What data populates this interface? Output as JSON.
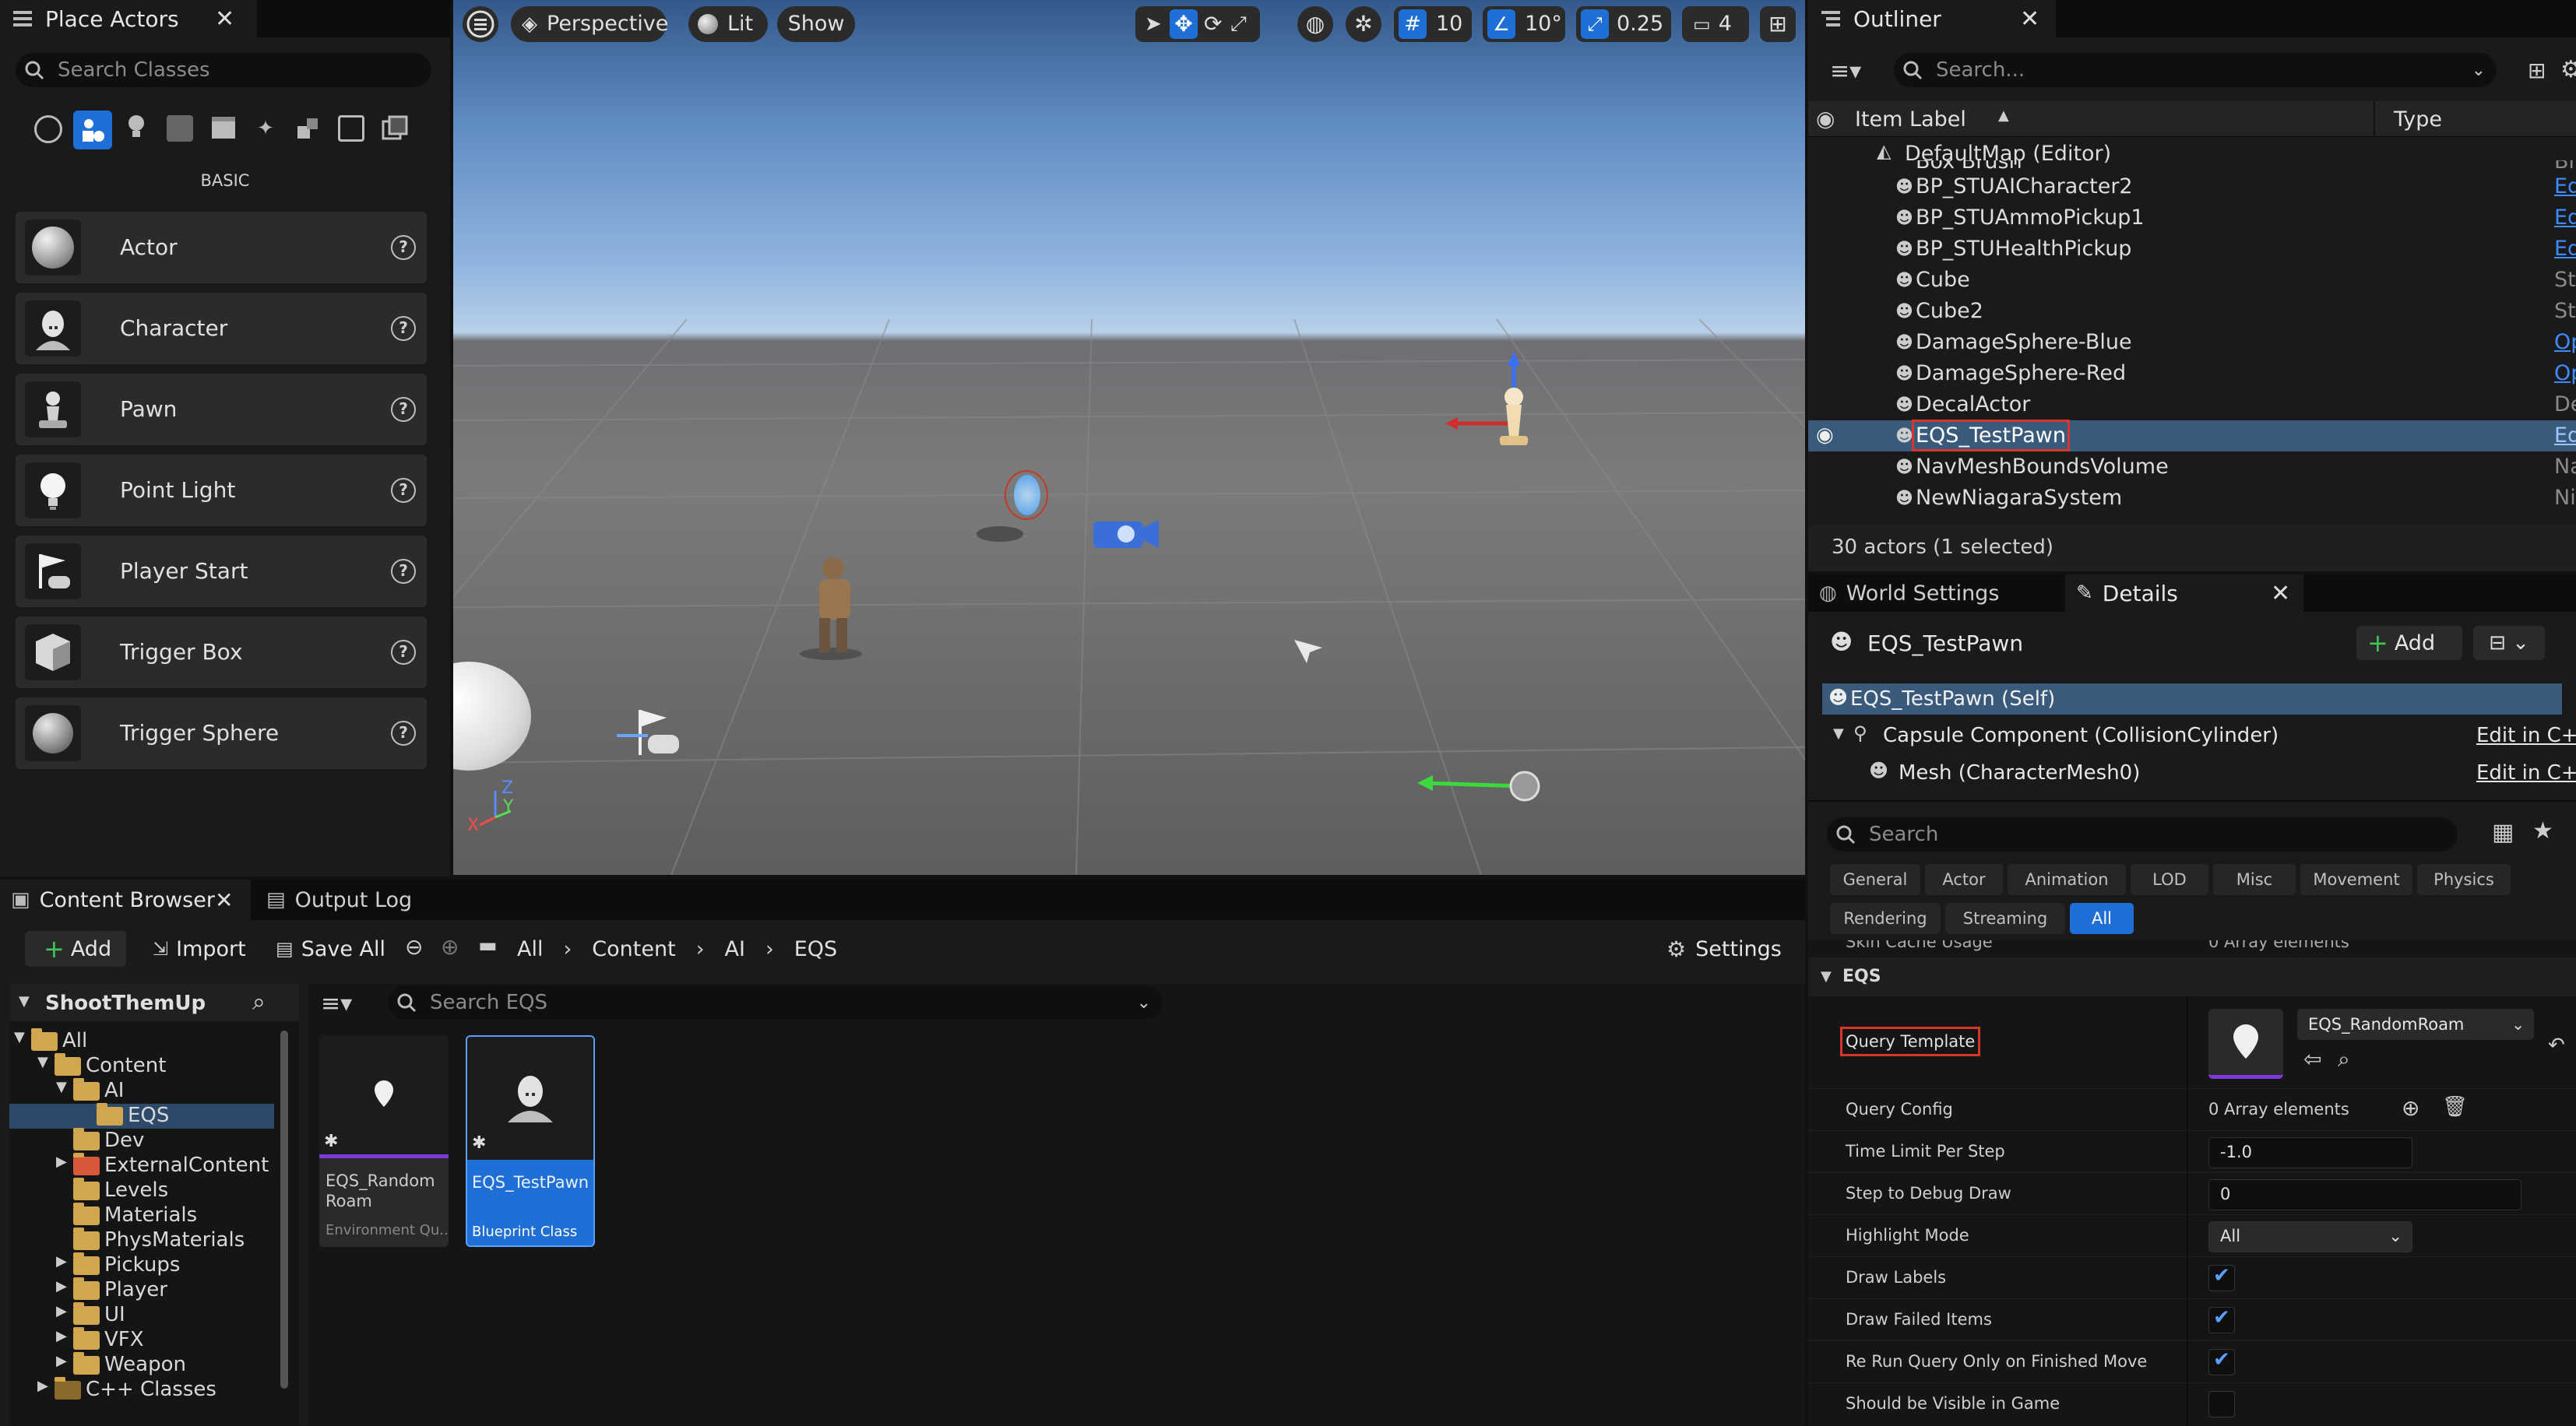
{
  "place_actors": {
    "tab_title": "Place Actors",
    "search_placeholder": "Search Classes",
    "section_label": "BASIC",
    "items": [
      {
        "label": "Actor",
        "icon": "sphere-icon"
      },
      {
        "label": "Character",
        "icon": "character-icon"
      },
      {
        "label": "Pawn",
        "icon": "pawn-icon"
      },
      {
        "label": "Point Light",
        "icon": "light-bulb-icon"
      },
      {
        "label": "Player Start",
        "icon": "player-start-icon"
      },
      {
        "label": "Trigger Box",
        "icon": "trigger-box-icon"
      },
      {
        "label": "Trigger Sphere",
        "icon": "trigger-sphere-icon"
      }
    ]
  },
  "viewport": {
    "perspective": "Perspective",
    "lit": "Lit",
    "show": "Show",
    "grid_snap": "10",
    "rotation_snap": "10°",
    "scale_snap": "0.25",
    "camera_speed": "4",
    "axis_z": "Z",
    "axis_y": "Y",
    "axis_x": "X"
  },
  "outliner": {
    "tab_title": "Outliner",
    "search_placeholder": "Search...",
    "col_label": "Item Label",
    "col_type": "Type",
    "root": "DefaultMap (Editor)",
    "partial_row": {
      "name": "Box Brush",
      "type": "Brush"
    },
    "rows": [
      {
        "name": "BP_STUAICharacter2",
        "type": "Edit BP_STUAIChara",
        "link": true
      },
      {
        "name": "BP_STUAmmoPickup1",
        "type": "Edit BP_STUAmmoP",
        "link": true
      },
      {
        "name": "BP_STUHealthPickup",
        "type": "Edit BP_STUHealthP",
        "link": true
      },
      {
        "name": "Cube",
        "type": "StaticMeshActor",
        "link": false
      },
      {
        "name": "Cube2",
        "type": "StaticMeshActor",
        "link": false
      },
      {
        "name": "DamageSphere-Blue",
        "type": "Open STUDevDamag",
        "link": true
      },
      {
        "name": "DamageSphere-Red",
        "type": "Open STUDevDamag",
        "link": true
      },
      {
        "name": "DecalActor",
        "type": "DecalActor",
        "link": false
      },
      {
        "name": "EQS_TestPawn",
        "type": "Edit EQS_TestPawn",
        "link": true,
        "selected": true
      },
      {
        "name": "NavMeshBoundsVolume",
        "type": "NavMeshBoundsVolu",
        "link": false
      },
      {
        "name": "NewNiagaraSystem",
        "type": "NiagaraActor",
        "link": false
      }
    ],
    "status": "30 actors (1 selected)"
  },
  "details": {
    "tab_world": "World Settings",
    "tab_details": "Details",
    "object_name": "EQS_TestPawn",
    "add_label": "Add",
    "components": [
      {
        "label": "EQS_TestPawn (Self)",
        "action": ""
      },
      {
        "label": "Capsule Component (CollisionCylinder)",
        "action": "Edit in C++"
      },
      {
        "label": "Mesh (CharacterMesh0)",
        "action": "Edit in C++"
      }
    ],
    "search_placeholder": "Search",
    "categories": [
      "General",
      "Actor",
      "Animation",
      "LOD",
      "Misc",
      "Movement",
      "Physics",
      "Rendering",
      "Streaming",
      "All"
    ],
    "partial_prop": {
      "label": "Skin Cache Usage",
      "value": "0 Array elements"
    },
    "section": "EQS",
    "query_template_label": "Query Template",
    "query_template_value": "EQS_RandomRoam",
    "props": [
      {
        "label": "Query Config",
        "value": "0 Array elements"
      },
      {
        "label": "Time Limit Per Step",
        "value": "-1.0"
      },
      {
        "label": "Step to Debug Draw",
        "value": "0"
      },
      {
        "label": "Highlight Mode",
        "value": "All"
      },
      {
        "label": "Draw Labels",
        "checked": true
      },
      {
        "label": "Draw Failed Items",
        "checked": true
      },
      {
        "label": "Re Run Query Only on Finished Move",
        "checked": true
      },
      {
        "label": "Should be Visible in Game",
        "checked": false
      }
    ]
  },
  "content_browser": {
    "tab_title": "Content Browser",
    "tab_output": "Output Log",
    "add": "Add",
    "import": "Import",
    "save_all": "Save All",
    "breadcrumb": [
      "All",
      "Content",
      "AI",
      "EQS"
    ],
    "settings": "Settings",
    "project": "ShootThemUp",
    "search_placeholder": "Search EQS",
    "tree": [
      {
        "label": "All",
        "depth": 0,
        "expanded": true
      },
      {
        "label": "Content",
        "depth": 1,
        "expanded": true
      },
      {
        "label": "AI",
        "depth": 2,
        "expanded": true
      },
      {
        "label": "EQS",
        "depth": 3,
        "selected": true
      },
      {
        "label": "Dev",
        "depth": 2
      },
      {
        "label": "ExternalContent",
        "depth": 2,
        "collapsed": true
      },
      {
        "label": "Levels",
        "depth": 2
      },
      {
        "label": "Materials",
        "depth": 2
      },
      {
        "label": "PhysMaterials",
        "depth": 2
      },
      {
        "label": "Pickups",
        "depth": 2,
        "collapsed": true
      },
      {
        "label": "Player",
        "depth": 2,
        "collapsed": true
      },
      {
        "label": "UI",
        "depth": 2,
        "collapsed": true
      },
      {
        "label": "VFX",
        "depth": 2,
        "collapsed": true
      },
      {
        "label": "Weapon",
        "depth": 2,
        "collapsed": true
      },
      {
        "label": "C++ Classes",
        "depth": 1,
        "collapsed": true
      }
    ],
    "assets": [
      {
        "name": "EQS_Random Roam",
        "type": "Environment Qu..."
      },
      {
        "name": "EQS_TestPawn",
        "type": "Blueprint Class"
      }
    ]
  },
  "colors": {
    "accent": "#1f6fd6",
    "selection": "#2e4a6b",
    "link": "#3d8bff",
    "highlight_box": "#d7372b"
  }
}
